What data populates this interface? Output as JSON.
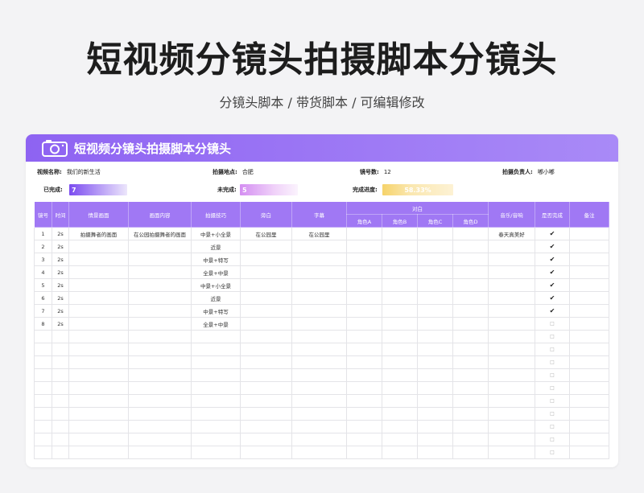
{
  "hero": {
    "title": "短视频分镜头拍摄脚本分镜头",
    "subtitle": "分镜头脚本 / 带货脚本 / 可编辑修改"
  },
  "card": {
    "title": "短视频分镜头拍摄脚本分镜头",
    "icon": "camera-icon"
  },
  "info": {
    "video_name_label": "视频名称:",
    "video_name_value": "我们的新生活",
    "location_label": "拍摄地点:",
    "location_value": "合肥",
    "shots_label": "镜号数:",
    "shots_value": "12",
    "owner_label": "拍摄负责人:",
    "owner_value": "嘟小嘟",
    "done_label": "已完成:",
    "done_value": "7",
    "undone_label": "未完成:",
    "undone_value": "5",
    "progress_label": "完成进度:",
    "progress_value": "58.33%"
  },
  "table": {
    "headers": {
      "shot_no": "镜号",
      "time": "时间",
      "scene": "情景画面",
      "content": "画面内容",
      "technique": "拍摄技巧",
      "narration": "旁白",
      "subtitle": "字幕",
      "dialogue": "对白",
      "role_a": "角色A",
      "role_b": "角色B",
      "role_c": "角色C",
      "role_d": "角色D",
      "music": "音乐/音响",
      "completed": "是否完成",
      "note": "备注"
    },
    "rows": [
      {
        "no": "1",
        "time": "2s",
        "scene": "拍摄舞者的画面",
        "content": "在公园拍摄舞者的画面",
        "technique": "中景+小全景",
        "narration": "在公园里",
        "subtitle": "在公园里",
        "a": "",
        "b": "",
        "c": "",
        "d": "",
        "music": "春天真美好",
        "done": "✔",
        "note": ""
      },
      {
        "no": "2",
        "time": "2s",
        "scene": "",
        "content": "",
        "technique": "近景",
        "narration": "",
        "subtitle": "",
        "a": "",
        "b": "",
        "c": "",
        "d": "",
        "music": "",
        "done": "✔",
        "note": ""
      },
      {
        "no": "3",
        "time": "2s",
        "scene": "",
        "content": "",
        "technique": "中景+特写",
        "narration": "",
        "subtitle": "",
        "a": "",
        "b": "",
        "c": "",
        "d": "",
        "music": "",
        "done": "✔",
        "note": ""
      },
      {
        "no": "4",
        "time": "2s",
        "scene": "",
        "content": "",
        "technique": "全景+中景",
        "narration": "",
        "subtitle": "",
        "a": "",
        "b": "",
        "c": "",
        "d": "",
        "music": "",
        "done": "✔",
        "note": ""
      },
      {
        "no": "5",
        "time": "2s",
        "scene": "",
        "content": "",
        "technique": "中景+小全景",
        "narration": "",
        "subtitle": "",
        "a": "",
        "b": "",
        "c": "",
        "d": "",
        "music": "",
        "done": "✔",
        "note": ""
      },
      {
        "no": "6",
        "time": "2s",
        "scene": "",
        "content": "",
        "technique": "近景",
        "narration": "",
        "subtitle": "",
        "a": "",
        "b": "",
        "c": "",
        "d": "",
        "music": "",
        "done": "✔",
        "note": ""
      },
      {
        "no": "7",
        "time": "2s",
        "scene": "",
        "content": "",
        "technique": "中景+特写",
        "narration": "",
        "subtitle": "",
        "a": "",
        "b": "",
        "c": "",
        "d": "",
        "music": "",
        "done": "✔",
        "note": ""
      },
      {
        "no": "8",
        "time": "2s",
        "scene": "",
        "content": "",
        "technique": "全景+中景",
        "narration": "",
        "subtitle": "",
        "a": "",
        "b": "",
        "c": "",
        "d": "",
        "music": "",
        "done": "□",
        "note": ""
      },
      {
        "no": "",
        "time": "",
        "scene": "",
        "content": "",
        "technique": "",
        "narration": "",
        "subtitle": "",
        "a": "",
        "b": "",
        "c": "",
        "d": "",
        "music": "",
        "done": "□",
        "note": ""
      },
      {
        "no": "",
        "time": "",
        "scene": "",
        "content": "",
        "technique": "",
        "narration": "",
        "subtitle": "",
        "a": "",
        "b": "",
        "c": "",
        "d": "",
        "music": "",
        "done": "□",
        "note": ""
      },
      {
        "no": "",
        "time": "",
        "scene": "",
        "content": "",
        "technique": "",
        "narration": "",
        "subtitle": "",
        "a": "",
        "b": "",
        "c": "",
        "d": "",
        "music": "",
        "done": "□",
        "note": ""
      },
      {
        "no": "",
        "time": "",
        "scene": "",
        "content": "",
        "technique": "",
        "narration": "",
        "subtitle": "",
        "a": "",
        "b": "",
        "c": "",
        "d": "",
        "music": "",
        "done": "□",
        "note": ""
      },
      {
        "no": "",
        "time": "",
        "scene": "",
        "content": "",
        "technique": "",
        "narration": "",
        "subtitle": "",
        "a": "",
        "b": "",
        "c": "",
        "d": "",
        "music": "",
        "done": "□",
        "note": ""
      },
      {
        "no": "",
        "time": "",
        "scene": "",
        "content": "",
        "technique": "",
        "narration": "",
        "subtitle": "",
        "a": "",
        "b": "",
        "c": "",
        "d": "",
        "music": "",
        "done": "□",
        "note": ""
      },
      {
        "no": "",
        "time": "",
        "scene": "",
        "content": "",
        "technique": "",
        "narration": "",
        "subtitle": "",
        "a": "",
        "b": "",
        "c": "",
        "d": "",
        "music": "",
        "done": "□",
        "note": ""
      },
      {
        "no": "",
        "time": "",
        "scene": "",
        "content": "",
        "technique": "",
        "narration": "",
        "subtitle": "",
        "a": "",
        "b": "",
        "c": "",
        "d": "",
        "music": "",
        "done": "□",
        "note": ""
      },
      {
        "no": "",
        "time": "",
        "scene": "",
        "content": "",
        "technique": "",
        "narration": "",
        "subtitle": "",
        "a": "",
        "b": "",
        "c": "",
        "d": "",
        "music": "",
        "done": "□",
        "note": ""
      },
      {
        "no": "",
        "time": "",
        "scene": "",
        "content": "",
        "technique": "",
        "narration": "",
        "subtitle": "",
        "a": "",
        "b": "",
        "c": "",
        "d": "",
        "music": "",
        "done": "□",
        "note": ""
      }
    ]
  },
  "colors": {
    "accent": "#a078f4",
    "header_gradient_start": "#8e63f2",
    "progress": "#f6d36a"
  }
}
